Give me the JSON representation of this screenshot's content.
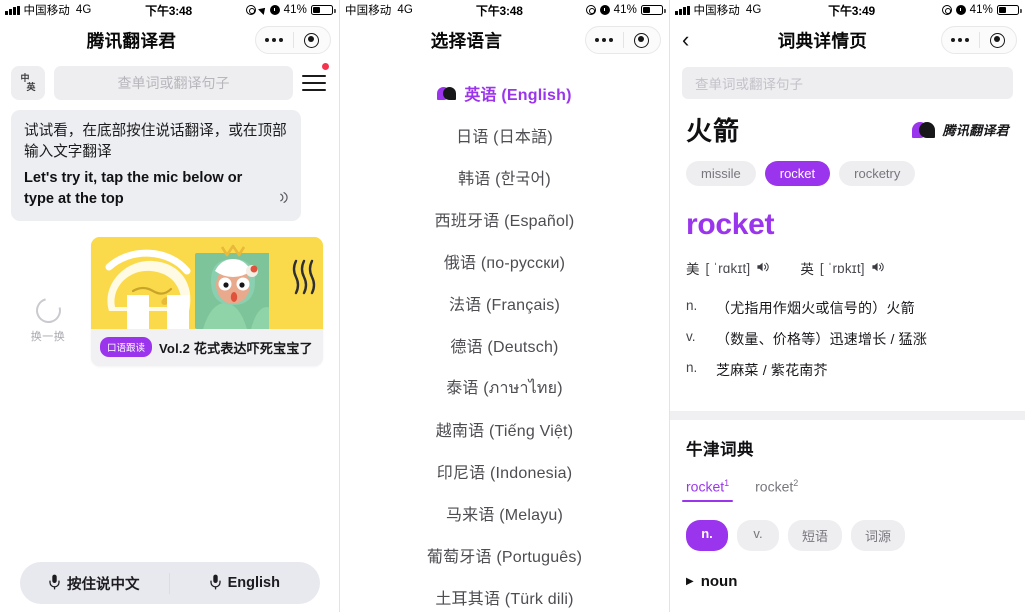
{
  "panel1": {
    "statusbar": {
      "carrier": "中国移动",
      "network": "4G",
      "time": "下午3:48",
      "battery": "41%"
    },
    "nav": {
      "title": "腾讯翻译君"
    },
    "lang_toggle": {
      "top": "中",
      "bottom": "英"
    },
    "search": {
      "placeholder": "查单词或翻译句子"
    },
    "bubble": {
      "cn": "试试看，在底部按住说话翻译，或在顶部输入文字翻译",
      "en": "Let's try it, tap the mic below or type at the top"
    },
    "refresh_label": "换一换",
    "promo": {
      "badge": "口语跟读",
      "title": "Vol.2 花式表达吓死宝宝了"
    },
    "mic": {
      "left": "按住说中文",
      "right": "English"
    }
  },
  "panel2": {
    "statusbar": {
      "carrier": "中国移动",
      "network": "4G",
      "time": "下午3:48",
      "battery": "41%"
    },
    "nav": {
      "title": "选择语言"
    },
    "languages": [
      {
        "label": "英语 (English)",
        "selected": true
      },
      {
        "label": "日语 (日本語)",
        "selected": false
      },
      {
        "label": "韩语 (한국어)",
        "selected": false
      },
      {
        "label": "西班牙语 (Español)",
        "selected": false
      },
      {
        "label": "俄语 (по-русски)",
        "selected": false
      },
      {
        "label": "法语 (Français)",
        "selected": false
      },
      {
        "label": "德语 (Deutsch)",
        "selected": false
      },
      {
        "label": "泰语 (ภาษาไทย)",
        "selected": false
      },
      {
        "label": "越南语 (Tiếng Việt)",
        "selected": false
      },
      {
        "label": "印尼语 (Indonesia)",
        "selected": false
      },
      {
        "label": "马来语 (Melayu)",
        "selected": false
      },
      {
        "label": "葡萄牙语 (Português)",
        "selected": false
      },
      {
        "label": "土耳其语 (Türk dili)",
        "selected": false
      }
    ]
  },
  "panel3": {
    "statusbar": {
      "carrier": "中国移动",
      "network": "4G",
      "time": "下午3:49",
      "battery": "41%"
    },
    "nav": {
      "title": "词典详情页",
      "back": "‹"
    },
    "search": {
      "placeholder": "查单词或翻译句子"
    },
    "zh_word": "火箭",
    "brand": "腾讯翻译君",
    "tags": [
      {
        "label": "missile",
        "active": false
      },
      {
        "label": "rocket",
        "active": true
      },
      {
        "label": "rocketry",
        "active": false
      }
    ],
    "en_word": "rocket",
    "phonetics": [
      {
        "region": "美",
        "ipa": "[ ˈrɑkɪt]"
      },
      {
        "region": "英",
        "ipa": "[ ˈrɒkɪt]"
      }
    ],
    "definitions": [
      {
        "pos": "n.",
        "text": "（尤指用作烟火或信号的）火箭"
      },
      {
        "pos": "v.",
        "text": "（数量、价格等）迅速增长 / 猛涨"
      },
      {
        "pos": "n.",
        "text": "芝麻菜 / 紫花南芥"
      }
    ],
    "oxford": {
      "title": "牛津词典",
      "tabs": [
        {
          "label": "rocket",
          "sup": "1",
          "active": true
        },
        {
          "label": "rocket",
          "sup": "2",
          "active": false
        }
      ],
      "chips": [
        {
          "label": "n.",
          "active": true
        },
        {
          "label": "v.",
          "active": false
        },
        {
          "label": "短语",
          "active": false
        },
        {
          "label": "词源",
          "active": false
        }
      ],
      "pos_head": "noun"
    }
  },
  "colors": {
    "accent": "#9b35ed",
    "card_yellow": "#fada4b",
    "badge_red": "#f5334f"
  }
}
